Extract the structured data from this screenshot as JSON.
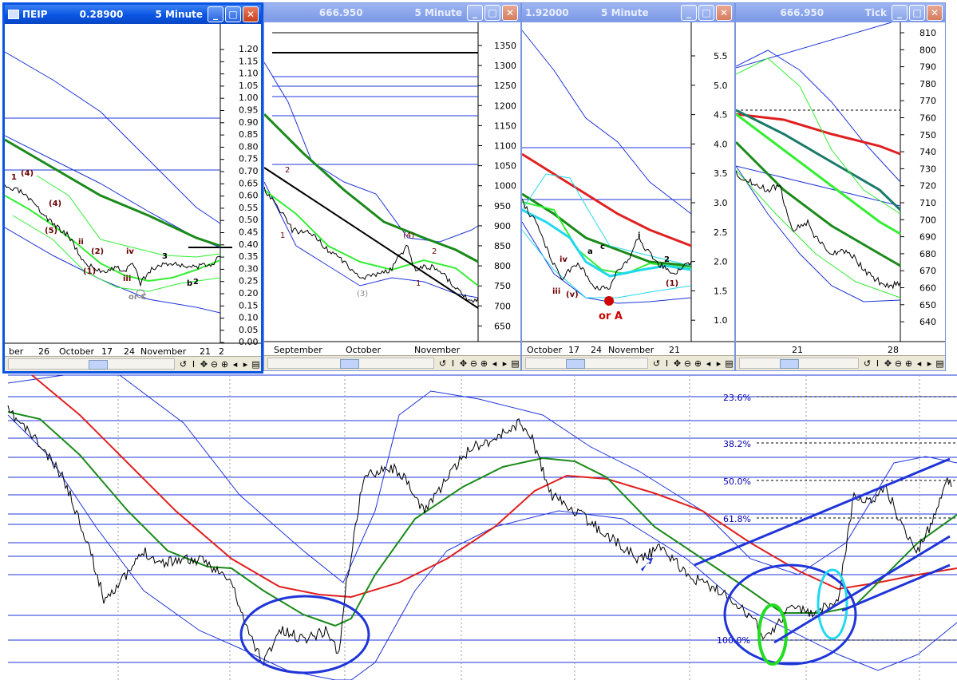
{
  "windows": [
    {
      "title_symbol": "ΠΕΙΡ",
      "title_price": "0.28900",
      "title_period": "5 Minute",
      "y_ticks": [
        "1.20",
        "1.15",
        "1.10",
        "1.05",
        "1.00",
        "0.95",
        "0.90",
        "0.85",
        "0.80",
        "0.75",
        "0.70",
        "0.65",
        "0.60",
        "0.55",
        "0.50",
        "0.45",
        "0.40",
        "0.35",
        "0.30",
        "0.25",
        "0.20",
        "0.15",
        "0.10",
        "0.05",
        "0.00"
      ],
      "x_ticks": [
        "ber",
        "26",
        "October",
        "17",
        "24",
        "November",
        "21",
        "2"
      ],
      "wave_labels": [
        "1",
        "(4)",
        "(5)",
        "(4)",
        "(2)",
        "(1)",
        "iv",
        "iii",
        "ii",
        "b",
        "2",
        "3",
        "or C"
      ]
    },
    {
      "title_symbol": "",
      "title_price": "666.950",
      "title_period": "5 Minute",
      "y_ticks": [
        "1350",
        "1300",
        "1250",
        "1200",
        "1150",
        "1100",
        "1050",
        "1000",
        "950",
        "900",
        "850",
        "800",
        "750",
        "700",
        "650"
      ],
      "x_ticks": [
        "September",
        "October",
        "November"
      ],
      "wave_labels": [
        "2",
        "1",
        "(3)",
        "(4)",
        "2",
        "1"
      ]
    },
    {
      "title_symbol": "",
      "title_price": "1.92000",
      "title_period": "5 Minute",
      "y_ticks": [
        "5.5",
        "5.0",
        "4.5",
        "4.0",
        "3.5",
        "3.0",
        "2.5",
        "2.0",
        "1.5",
        "1.0"
      ],
      "x_ticks": [
        "October",
        "17",
        "24",
        "November",
        "21"
      ],
      "wave_labels": [
        "iv",
        "iii",
        "(v)",
        "a",
        "c",
        "i",
        "2",
        "(1)",
        "or A"
      ]
    },
    {
      "title_symbol": "",
      "title_price": "666.950",
      "title_period": "Tick",
      "y_ticks": [
        "810",
        "800",
        "790",
        "780",
        "770",
        "760",
        "750",
        "740",
        "730",
        "720",
        "710",
        "700",
        "690",
        "680",
        "670",
        "660",
        "650",
        "640"
      ],
      "x_ticks": [
        "21",
        "28"
      ],
      "wave_labels": []
    }
  ],
  "main_chart": {
    "fib_labels": [
      "23.6%",
      "38.2%",
      "50.0%",
      "61.8%",
      "100.0%"
    ]
  },
  "chart_data": [
    {
      "type": "line",
      "panel": "ΠΕΙΡ 5 Minute",
      "ylim": [
        0.0,
        1.22
      ],
      "x": [
        "ber",
        "26",
        "October",
        "17",
        "24",
        "November",
        "21"
      ],
      "series": [
        {
          "values": [
            0.62,
            0.58,
            0.47,
            0.4,
            0.3,
            0.22,
            0.2,
            0.22,
            0.28,
            0.29
          ]
        }
      ]
    },
    {
      "type": "line",
      "panel": "666.950 5 Minute",
      "ylim": [
        640,
        1370
      ],
      "x": [
        "September",
        "October",
        "November"
      ],
      "series": [
        {
          "values": [
            900,
            850,
            800,
            760,
            740,
            735,
            780,
            780,
            760,
            700,
            670
          ]
        }
      ]
    },
    {
      "type": "line",
      "panel": "1.92000 5 Minute",
      "ylim": [
        0.8,
        5.9
      ],
      "x": [
        "October",
        "17",
        "24",
        "November",
        "21"
      ],
      "series": [
        {
          "values": [
            3.4,
            2.8,
            2.2,
            1.7,
            1.6,
            1.9,
            1.8,
            2.1,
            2.0,
            1.8,
            1.9
          ]
        }
      ]
    },
    {
      "type": "line",
      "panel": "666.950 Tick",
      "ylim": [
        635,
        812
      ],
      "x": [
        "21",
        "28"
      ],
      "series": [
        {
          "values": [
            720,
            712,
            718,
            700,
            690,
            680,
            673,
            667,
            660,
            666
          ]
        }
      ]
    }
  ]
}
